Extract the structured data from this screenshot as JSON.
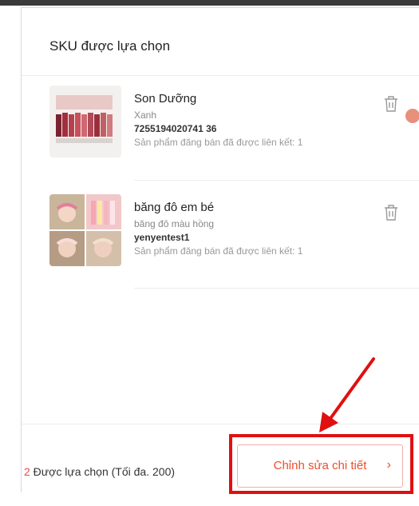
{
  "title": "SKU được lựa chọn",
  "items": [
    {
      "name": "Son Dưỡng",
      "variant": "Xanh",
      "sku": "7255194020741 36",
      "linked": "Sản phẩm đăng bán đã được liên kết: 1",
      "thumb_icon": "lipstick-product-image"
    },
    {
      "name": "băng đô em bé",
      "variant": "băng đô màu hồng",
      "sku": "yenyentest1",
      "linked": "Sản phẩm đăng bán đã được liên kết: 1",
      "thumb_icon": "baby-headband-product-image"
    }
  ],
  "footer": {
    "count": "2",
    "count_text": " Được lựa chọn (Tối đa. 200)",
    "edit_button": "Chỉnh sửa chi tiết",
    "edit_chevron": "›"
  },
  "colors": {
    "accent": "#ee4d2d",
    "highlight": "#e01010"
  }
}
